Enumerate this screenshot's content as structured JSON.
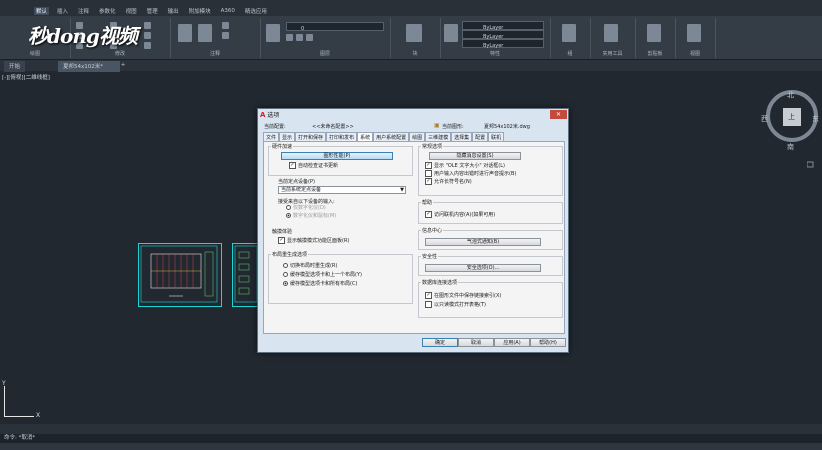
{
  "app": {
    "menu": [
      "默认",
      "插入",
      "注释",
      "参数化",
      "视图",
      "管理",
      "输出",
      "附加模块",
      "A360",
      "精选应用"
    ],
    "ribbon_groups": [
      "绘图",
      "修改",
      "注释",
      "图层",
      "块",
      "特性",
      "组",
      "实用工具",
      "剪贴板",
      "视图"
    ],
    "layer_value": "0",
    "bylayer1": "ByLayer",
    "bylayer2": "ByLayer",
    "bylayer3": "ByLayer"
  },
  "watermark": "秒dong视频",
  "file_tabs": {
    "start": "开始",
    "drawing": "夏邦54x102米*",
    "new_tab": "+"
  },
  "viewport_label": "[-][俯视][二维线框]",
  "viewcube": {
    "north": "北",
    "south": "南",
    "east": "东",
    "west": "西",
    "face": "上"
  },
  "ucs": {
    "x": "X",
    "y": "Y"
  },
  "command": {
    "prompt": "命令: *取消*"
  },
  "dialog": {
    "title": "选项",
    "close": "✕",
    "current_profile_label": "当前配置:",
    "current_profile_value": "<<未命名配置>>",
    "current_drawing_label": "当前图形:",
    "current_drawing_value": "夏邦54x102米.dwg",
    "tabs": [
      "文件",
      "显示",
      "打开和保存",
      "打印和发布",
      "系统",
      "用户系统配置",
      "绘图",
      "三维建模",
      "选择集",
      "配置",
      "联机"
    ],
    "active_tab": "系统",
    "hw_accel": {
      "title": "硬件加速",
      "button": "图形性能(P)",
      "checkbox": "自动检查证书更新"
    },
    "pointing_device": {
      "title": "当前定点设备(P)",
      "value": "当前系统定点设备",
      "accept_label": "接受来自以下设备的输入:",
      "opt1": "仅数字化仪(D)",
      "opt2": "数字化仪和鼠标(M)"
    },
    "touch": {
      "title": "触摸体验",
      "checkbox": "显示触摸模式功能区面板(R)"
    },
    "layout_regen": {
      "title": "布局重生成选项",
      "opt1": "切换布局时重生成(R)",
      "opt2": "缓存模型选项卡和上一个布局(Y)",
      "opt3": "缓存模型选项卡和所有布局(C)"
    },
    "general": {
      "title": "常规选项",
      "button": "隐藏消息设置(S)",
      "chk1": "显示 \"OLE 文字大小\" 对话框(L)",
      "chk2": "用户输入内容出错时进行声音提示(B)",
      "chk3": "允许长符号名(N)"
    },
    "help": {
      "title": "帮助",
      "checkbox": "访问联机内容(A)(如果可用)"
    },
    "info_center": {
      "title": "信息中心",
      "button": "气泡式通知(B)"
    },
    "security": {
      "title": "安全性",
      "button": "安全选项(O)..."
    },
    "dbconnect": {
      "title": "数据库连接选项",
      "chk1": "在图形文件中保存链接索引(X)",
      "chk2": "以只读模式打开表格(T)"
    },
    "footer": {
      "ok": "确定",
      "cancel": "取消",
      "apply": "应用(A)",
      "help": "帮助(H)"
    }
  }
}
